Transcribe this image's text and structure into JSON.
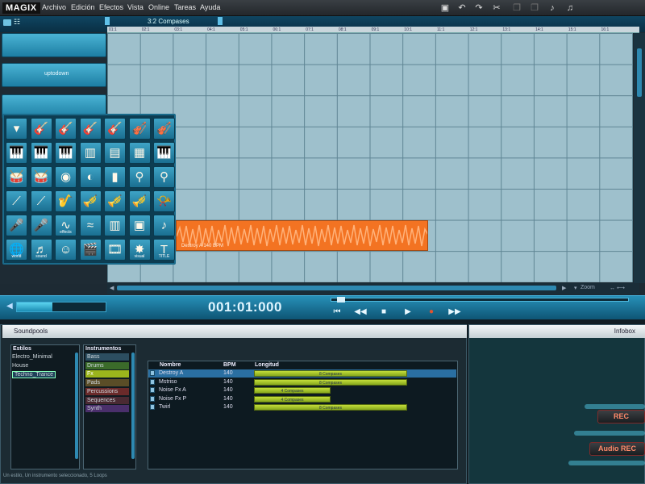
{
  "app": {
    "logo": "MAGIX"
  },
  "menu": {
    "items": [
      "Archivo",
      "Edición",
      "Efectos",
      "Vista",
      "Online",
      "Tareas",
      "Ayuda"
    ]
  },
  "toolbar": {
    "icons": [
      "save-icon",
      "undo-icon",
      "redo-icon",
      "scissors-icon",
      "copy-icon",
      "paste-icon",
      "note-icon",
      "notes-icon"
    ]
  },
  "arrange": {
    "ruler_label": "3:2 Compases",
    "ruler_marks": [
      "01:1",
      "02:1",
      "03:1",
      "04:1",
      "05:1",
      "06:1",
      "07:1",
      "08:1",
      "09:1",
      "10:1",
      "11:1",
      "12:1",
      "13:1",
      "14:1",
      "15:1",
      "16:1"
    ],
    "tracks": [
      {
        "name": ""
      },
      {
        "name": "uptodown"
      },
      {
        "name": ""
      }
    ],
    "zoom_label": "Zoom"
  },
  "clip": {
    "label": "Destroy A 140 BPM"
  },
  "palette": {
    "rows": [
      [
        "dropdown-arrow",
        "guitar",
        "electric-guitar",
        "bass-guitar",
        "electric-bass",
        "violin",
        "cello"
      ],
      [
        "grand-piano",
        "keyboard",
        "synth-keys",
        "organ",
        "harmonium",
        "accordion",
        "keyboard-2"
      ],
      [
        "drum-kit",
        "snare-drum",
        "bass-drum",
        "cymbal",
        "bongos",
        "maraca",
        "shaker"
      ],
      [
        "flute",
        "clarinet",
        "saxophone",
        "trumpet",
        "tuba",
        "trombone",
        "horn"
      ],
      [
        "microphone",
        "mic-pop",
        "effects",
        "wave",
        "mixer",
        "sampler",
        "note"
      ],
      [
        "world",
        "sound",
        "crowd",
        "clapper",
        "film",
        "visual",
        "title"
      ]
    ],
    "labels": {
      "effects": "effects",
      "world": "world",
      "sound": "sound",
      "visual": "visual",
      "title": "TITLE"
    }
  },
  "transport": {
    "timecode": "001:01:000",
    "volume": 0.4,
    "position": 0.02
  },
  "soundpools": {
    "tab_label": "Soundpools",
    "estilos_header": "Estilos",
    "estilos": [
      "Electro_Minimal",
      "House",
      "Techno_Trance"
    ],
    "estilo_selected": 2,
    "instrumentos_header": "Instrumentos",
    "instrumentos": [
      {
        "name": "Bass",
        "color": "#2c4e60"
      },
      {
        "name": "Drums",
        "color": "#3b6b2a"
      },
      {
        "name": "Fx",
        "color": "#9bb51c"
      },
      {
        "name": "Pads",
        "color": "#5a4d27"
      },
      {
        "name": "Percussions",
        "color": "#6a2a2a"
      },
      {
        "name": "Sequences",
        "color": "#4a2a33"
      },
      {
        "name": "Synth",
        "color": "#4a2f6b"
      }
    ],
    "table": {
      "headers": {
        "name": "Nombre",
        "bpm": "BPM",
        "length": "Longitud"
      },
      "rows": [
        {
          "name": "Destroy A",
          "bpm": "140",
          "length": "8 Compases",
          "bars": 8,
          "selected": true
        },
        {
          "name": "Mstriso",
          "bpm": "140",
          "length": "8 Compases",
          "bars": 8,
          "selected": false
        },
        {
          "name": "Noise Fx A",
          "bpm": "140",
          "length": "4 Compases",
          "bars": 4,
          "selected": false
        },
        {
          "name": "Noise Fx P",
          "bpm": "140",
          "length": "4 Compases",
          "bars": 4,
          "selected": false
        },
        {
          "name": "Twirl",
          "bpm": "140",
          "length": "8 Compases",
          "bars": 8,
          "selected": false
        }
      ]
    },
    "status": "Un estilo, Un instrumento seleccionado, 5 Loops"
  },
  "infobox": {
    "tab_label": "Infobox",
    "rec_label": "REC",
    "audio_rec_label": "Audio REC"
  }
}
